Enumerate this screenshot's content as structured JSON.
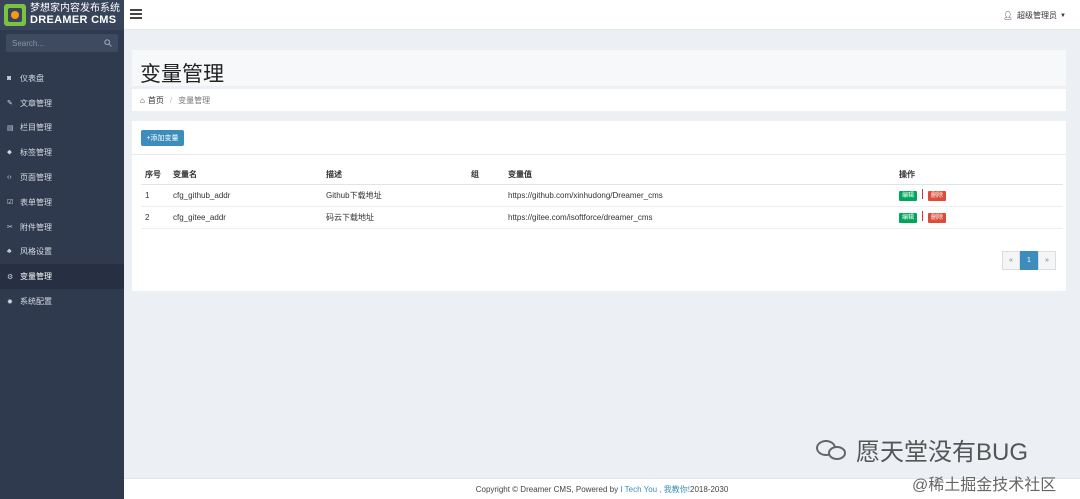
{
  "brand": {
    "cn_name": "梦想家内容发布系统",
    "en_name": "Dreamer CMS"
  },
  "search": {
    "placeholder": "Search..."
  },
  "sidebar": {
    "items": [
      {
        "label": "仪表盘",
        "icon": "dashboard-icon",
        "glyph": "◙"
      },
      {
        "label": "文章管理",
        "icon": "edit-icon",
        "glyph": "✎"
      },
      {
        "label": "栏目管理",
        "icon": "columns-icon",
        "glyph": "▤"
      },
      {
        "label": "标签管理",
        "icon": "tags-icon",
        "glyph": "⬥"
      },
      {
        "label": "页面管理",
        "icon": "code-icon",
        "glyph": "‹›"
      },
      {
        "label": "表单管理",
        "icon": "check-square-icon",
        "glyph": "☑"
      },
      {
        "label": "附件管理",
        "icon": "paperclip-icon",
        "glyph": "✂"
      },
      {
        "label": "风格设置",
        "icon": "sitemap-icon",
        "glyph": "♣"
      },
      {
        "label": "变量管理",
        "icon": "cogs-icon",
        "glyph": "⚙",
        "active": true
      },
      {
        "label": "系统配置",
        "icon": "gear-icon",
        "glyph": "✹"
      }
    ]
  },
  "header": {
    "user": "超级管理员"
  },
  "page": {
    "title": "变量管理",
    "breadcrumb": {
      "home": "首页",
      "current": "变量管理"
    },
    "add_button": "+添加变量"
  },
  "table": {
    "columns": [
      "序号",
      "变量名",
      "描述",
      "组",
      "变量值",
      "操作"
    ],
    "rows": [
      {
        "index": "1",
        "name": "cfg_github_addr",
        "desc": "Github下载地址",
        "group": "",
        "value": "https://github.com/xinhudong/Dreamer_cms"
      },
      {
        "index": "2",
        "name": "cfg_gitee_addr",
        "desc": "码云下载地址",
        "group": "",
        "value": "https://gitee.com/isoftforce/dreamer_cms"
      }
    ],
    "edit_label": "编辑",
    "delete_label": "删除"
  },
  "pagination": {
    "prev": "«",
    "current": "1",
    "next": "»"
  },
  "footer": {
    "prefix": "Copyright © Dreamer CMS, Powered by ",
    "link": "I Tech You , 我教你!",
    "years": " 2018-2030"
  },
  "watermark": {
    "line1": "愿天堂没有BUG",
    "line2": "@稀土掘金技术社区"
  }
}
